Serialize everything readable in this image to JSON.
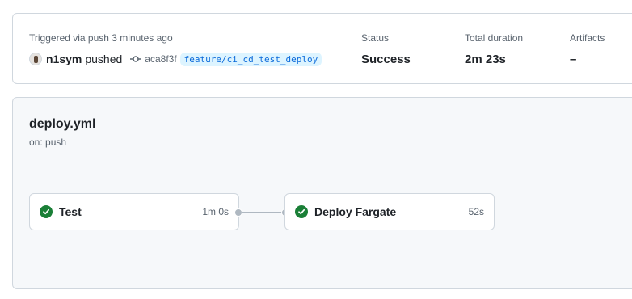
{
  "summary": {
    "trigger_text": "Triggered via push 3 minutes ago",
    "actor": "n1sym",
    "action": "pushed",
    "commit_sha": "aca8f3f",
    "branch": "feature/ci_cd_test_deploy",
    "status_label": "Status",
    "status_value": "Success",
    "duration_label": "Total duration",
    "duration_value": "2m 23s",
    "artifacts_label": "Artifacts",
    "artifacts_value": "–"
  },
  "workflow": {
    "name": "deploy.yml",
    "trigger": "on: push",
    "jobs": [
      {
        "name": "Test",
        "duration": "1m 0s",
        "status": "success",
        "status_icon": "check-circle-icon"
      },
      {
        "name": "Deploy Fargate",
        "duration": "52s",
        "status": "success",
        "status_icon": "check-circle-icon"
      }
    ]
  },
  "colors": {
    "success": "#1a7f37",
    "link": "#0969da",
    "branch_bg": "#ddf4ff",
    "muted_text": "#59636e",
    "border": "#d0d7de",
    "graph_bg": "#f6f8fa"
  }
}
